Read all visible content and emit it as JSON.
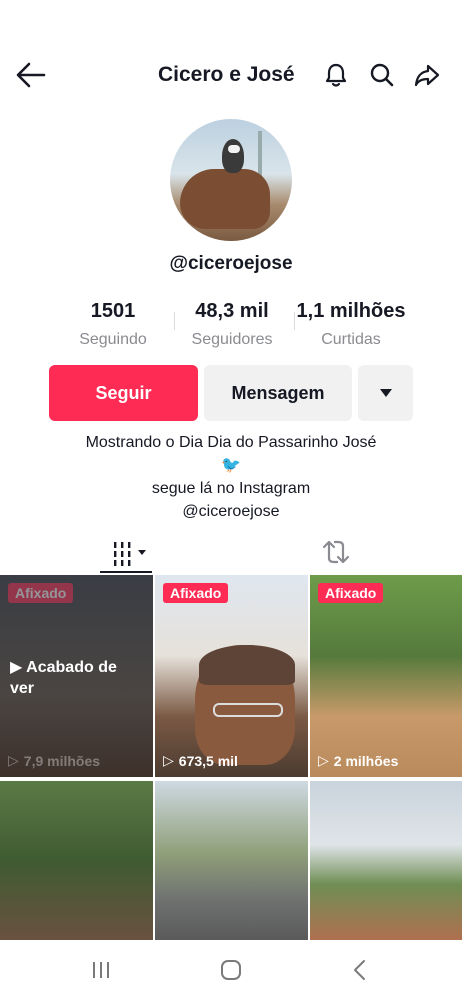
{
  "header": {
    "title": "Cicero e José",
    "icons": [
      "back-arrow-icon",
      "bell-icon",
      "search-icon",
      "share-icon"
    ]
  },
  "profile": {
    "handle": "@ciceroejose"
  },
  "stats": [
    {
      "value": "1501",
      "label": "Seguindo"
    },
    {
      "value": "48,3 mil",
      "label": "Seguidores"
    },
    {
      "value": "1,1 milhões",
      "label": "Curtidas"
    }
  ],
  "actions": {
    "follow": "Seguir",
    "message": "Mensagem"
  },
  "bio": {
    "line1": "Mostrando o Dia Dia do Passarinho José",
    "emoji": "🐦",
    "line2": "segue lá no Instagram",
    "line3": "@ciceroejose"
  },
  "videos": [
    {
      "pinned": "Afixado",
      "views": "7,9 milhões",
      "overlay": "Acabado de ver"
    },
    {
      "pinned": "Afixado",
      "views": "673,5 mil"
    },
    {
      "pinned": "Afixado",
      "views": "2 milhões"
    },
    {},
    {},
    {}
  ],
  "colors": {
    "accent": "#fe2c55",
    "text": "#161823",
    "muted": "#8a8b91",
    "button_bg": "#f1f1f2"
  }
}
